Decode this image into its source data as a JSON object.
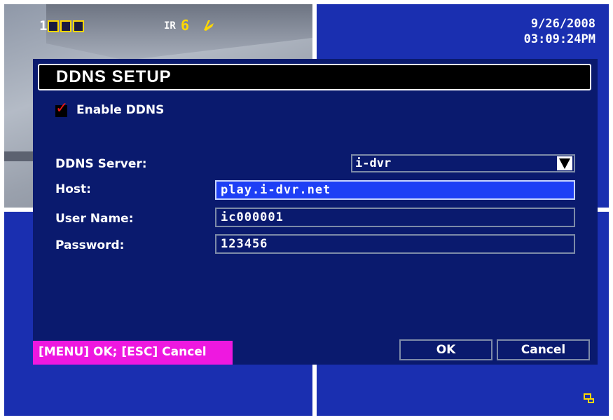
{
  "osd": {
    "camera_number": "1",
    "ir_label": "IR",
    "ir_value": "6",
    "date": "9/26/2008",
    "time": "03:09:24PM",
    "icons": {
      "camera_status": "camera-status-boxes",
      "audio": "audio-icon",
      "hdd": "hdd-icon"
    },
    "accent_color": "#ffd800"
  },
  "dialog": {
    "title": "DDNS SETUP",
    "enable_label": "Enable DDNS",
    "enable_checked": true,
    "server": {
      "label": "DDNS Server:",
      "value": "i-dvr"
    },
    "host": {
      "label": "Host:",
      "value": "play.i-dvr.net"
    },
    "username": {
      "label": "User Name:",
      "value": "ic000001"
    },
    "password": {
      "label": "Password:",
      "value": "123456"
    },
    "hint": "[MENU] OK; [ESC] Cancel",
    "ok_label": "OK",
    "cancel_label": "Cancel",
    "colors": {
      "background": "#0a1a6e",
      "active_field": "#1e3ff5",
      "hint_background": "#ee18e0"
    }
  }
}
